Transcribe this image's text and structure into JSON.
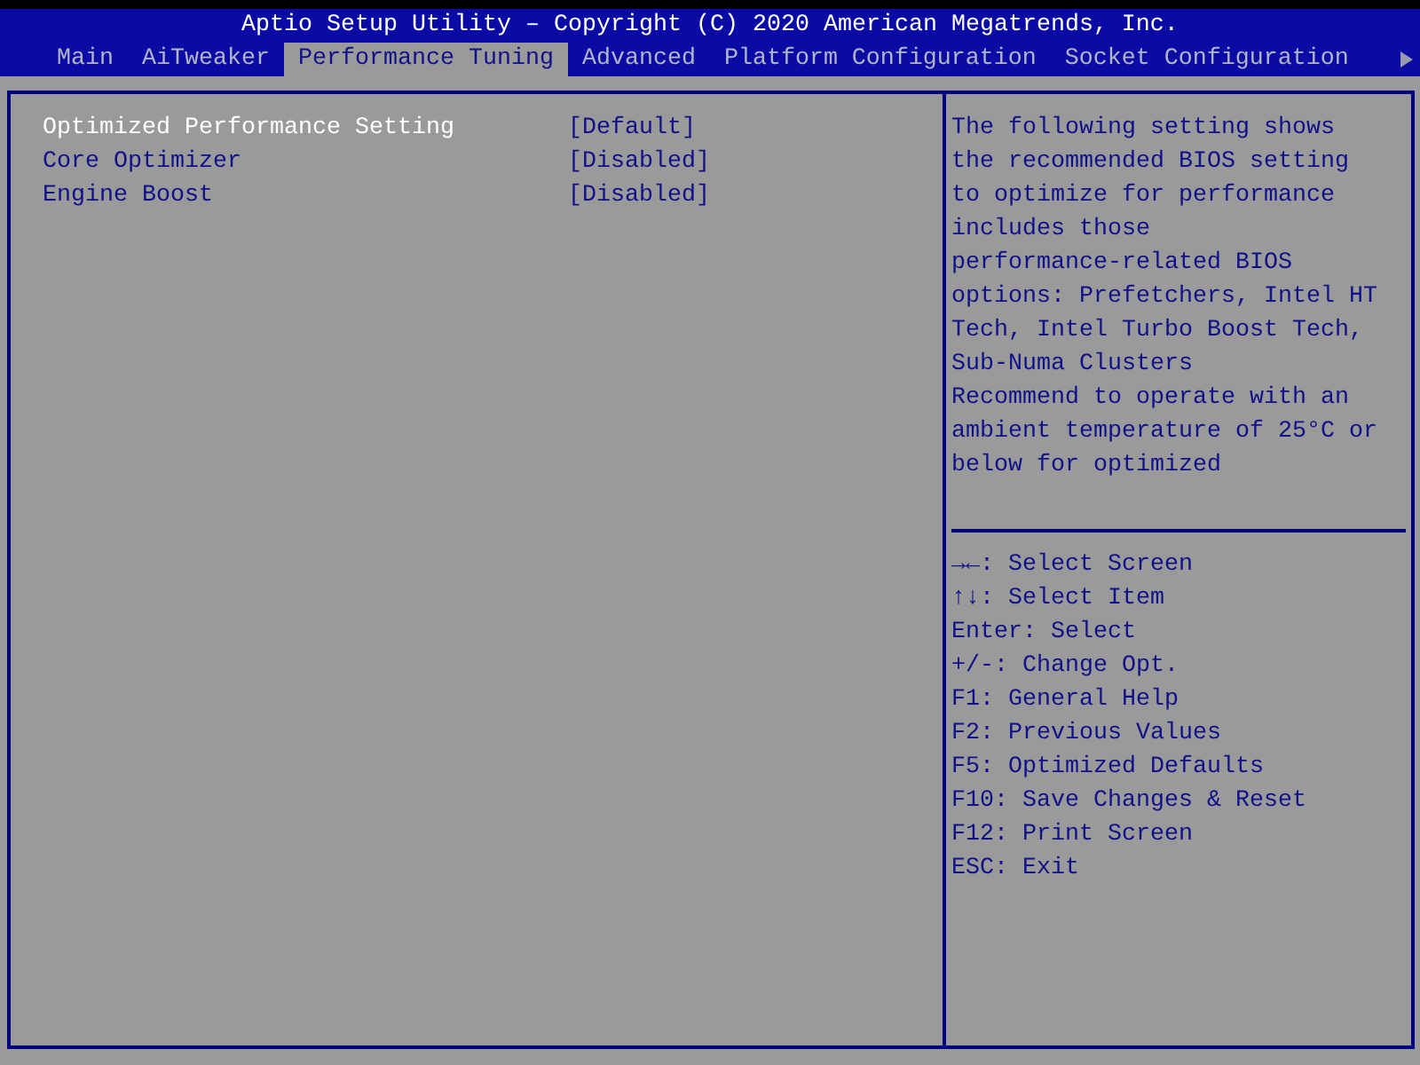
{
  "title_bar": {
    "title": "Aptio Setup Utility – Copyright (C) 2020 American Megatrends, Inc."
  },
  "tabs": [
    {
      "label": "Main",
      "selected": false
    },
    {
      "label": "AiTweaker",
      "selected": false
    },
    {
      "label": "Performance Tuning",
      "selected": true
    },
    {
      "label": "Advanced",
      "selected": false
    },
    {
      "label": "Platform Configuration",
      "selected": false
    },
    {
      "label": "Socket Configuration",
      "selected": false
    }
  ],
  "settings": [
    {
      "label": "Optimized Performance Setting",
      "value": "[Default]",
      "selected": true
    },
    {
      "label": "Core Optimizer",
      "value": "[Disabled]",
      "selected": false
    },
    {
      "label": "Engine Boost",
      "value": "[Disabled]",
      "selected": false
    }
  ],
  "help_text": [
    "The following setting shows\nthe recommended BIOS setting\nto optimize for performance\nincludes those\nperformance-related BIOS\noptions: Prefetchers, Intel HT\nTech, Intel Turbo Boost Tech,\nSub-Numa Clusters",
    "Recommend to operate with an\nambient temperature of 25°C or\nbelow for optimized"
  ],
  "key_help": [
    "**→←**: Select Screen",
    "**↑↓**: Select Item",
    "Enter: Select",
    "+/-: Change Opt.",
    "F1: General Help",
    "F2: Previous Values",
    "F5: Optimized Defaults",
    "F10: Save Changes & Reset",
    "F12: Print Screen",
    "ESC: Exit"
  ]
}
